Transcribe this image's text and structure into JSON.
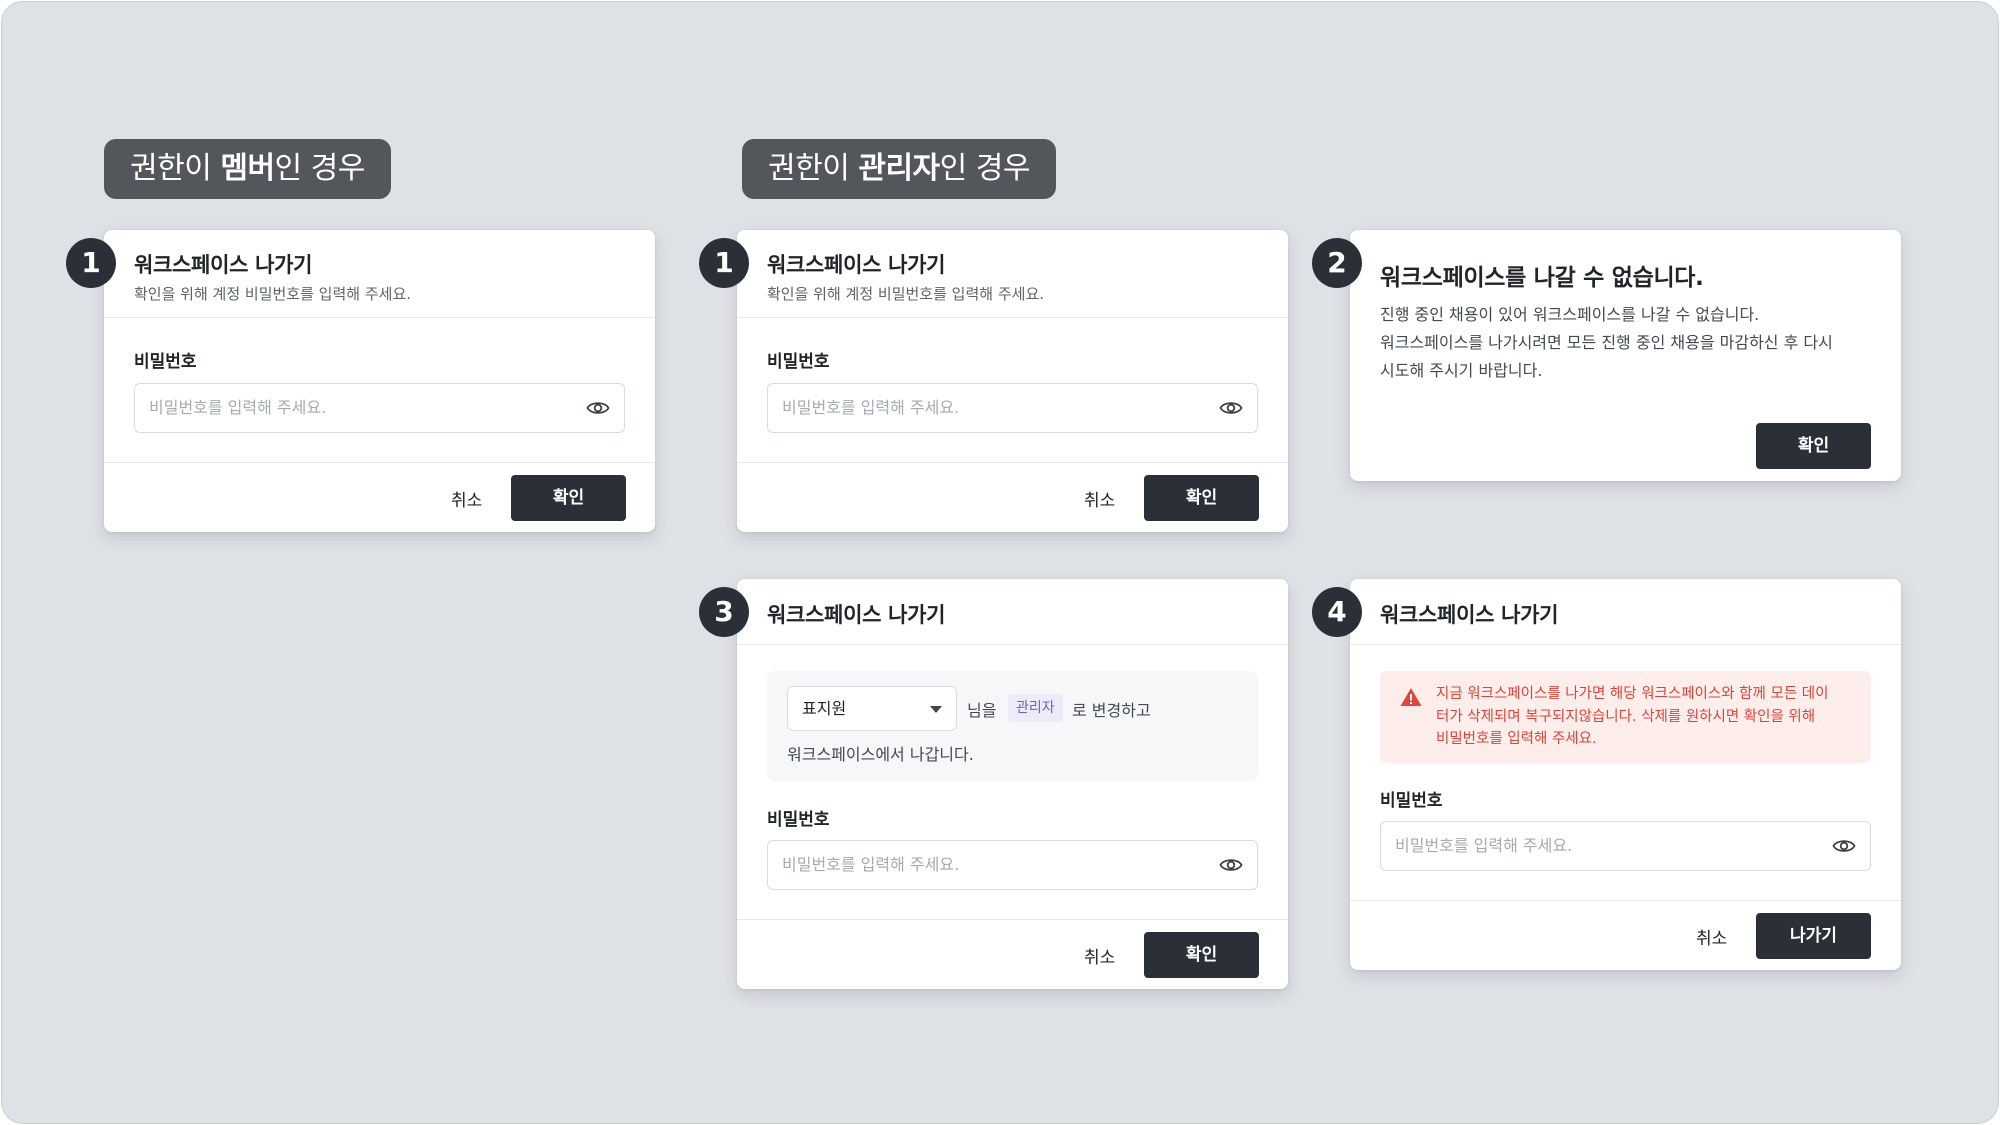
{
  "sections": {
    "member": {
      "pre": "권한이 ",
      "strong": "멤버",
      "post": "인 경우"
    },
    "admin": {
      "pre": "권한이 ",
      "strong": "관리자",
      "post": "인 경우"
    }
  },
  "cards": {
    "member_step1": {
      "badge": "1",
      "title": "워크스페이스 나가기",
      "subtitle": "확인을 위해 계정 비밀번호를 입력해 주세요.",
      "field_label": "비밀번호",
      "placeholder": "비밀번호를 입력해 주세요.",
      "cancel": "취소",
      "confirm": "확인"
    },
    "admin_step1": {
      "badge": "1",
      "title": "워크스페이스 나가기",
      "subtitle": "확인을 위해 계정 비밀번호를 입력해 주세요.",
      "field_label": "비밀번호",
      "placeholder": "비밀번호를 입력해 주세요.",
      "cancel": "취소",
      "confirm": "확인"
    },
    "admin_step2": {
      "badge": "2",
      "title": "워크스페이스를 나갈 수 없습니다.",
      "body_lines": [
        "진행 중인 채용이 있어 워크스페이스를 나갈 수 없습니다.",
        "워크스페이스를 나가시려면 모든 진행 중인 채용을 마감하신 후 다시",
        "시도해 주시기 바랍니다."
      ],
      "confirm": "확인"
    },
    "admin_step3": {
      "badge": "3",
      "title": "워크스페이스 나가기",
      "select_value": "표지원",
      "text_after_select": "님을",
      "role_chip": "관리자",
      "text_after_chip": "로 변경하고",
      "second_line": "워크스페이스에서 나갑니다.",
      "field_label": "비밀번호",
      "placeholder": "비밀번호를 입력해 주세요.",
      "cancel": "취소",
      "confirm": "확인"
    },
    "admin_step4": {
      "badge": "4",
      "title": "워크스페이스 나가기",
      "alert_lines": [
        "지금 워크스페이스를 나가면 해당 워크스페이스와 함께 모든 데이",
        "터가 삭제되며 복구되지않습니다. 삭제를 원하시면 확인을 위해",
        "비밀번호를 입력해 주세요."
      ],
      "field_label": "비밀번호",
      "placeholder": "비밀번호를 입력해 주세요.",
      "cancel": "취소",
      "leave": "나가기"
    }
  },
  "icons": {
    "badge": "step-number-badge",
    "password_toggle": "eye-icon",
    "dropdown": "chevron-down-icon",
    "alert": "warning-triangle-icon"
  },
  "colors": {
    "background": "#dee1e6",
    "primary_button": "#2b3038",
    "section_tag": "#53565b",
    "alert_bg": "#fdeeec",
    "alert_text": "#d9453a",
    "role_chip_bg": "#ecebfa",
    "role_chip_text": "#6b63c7"
  }
}
